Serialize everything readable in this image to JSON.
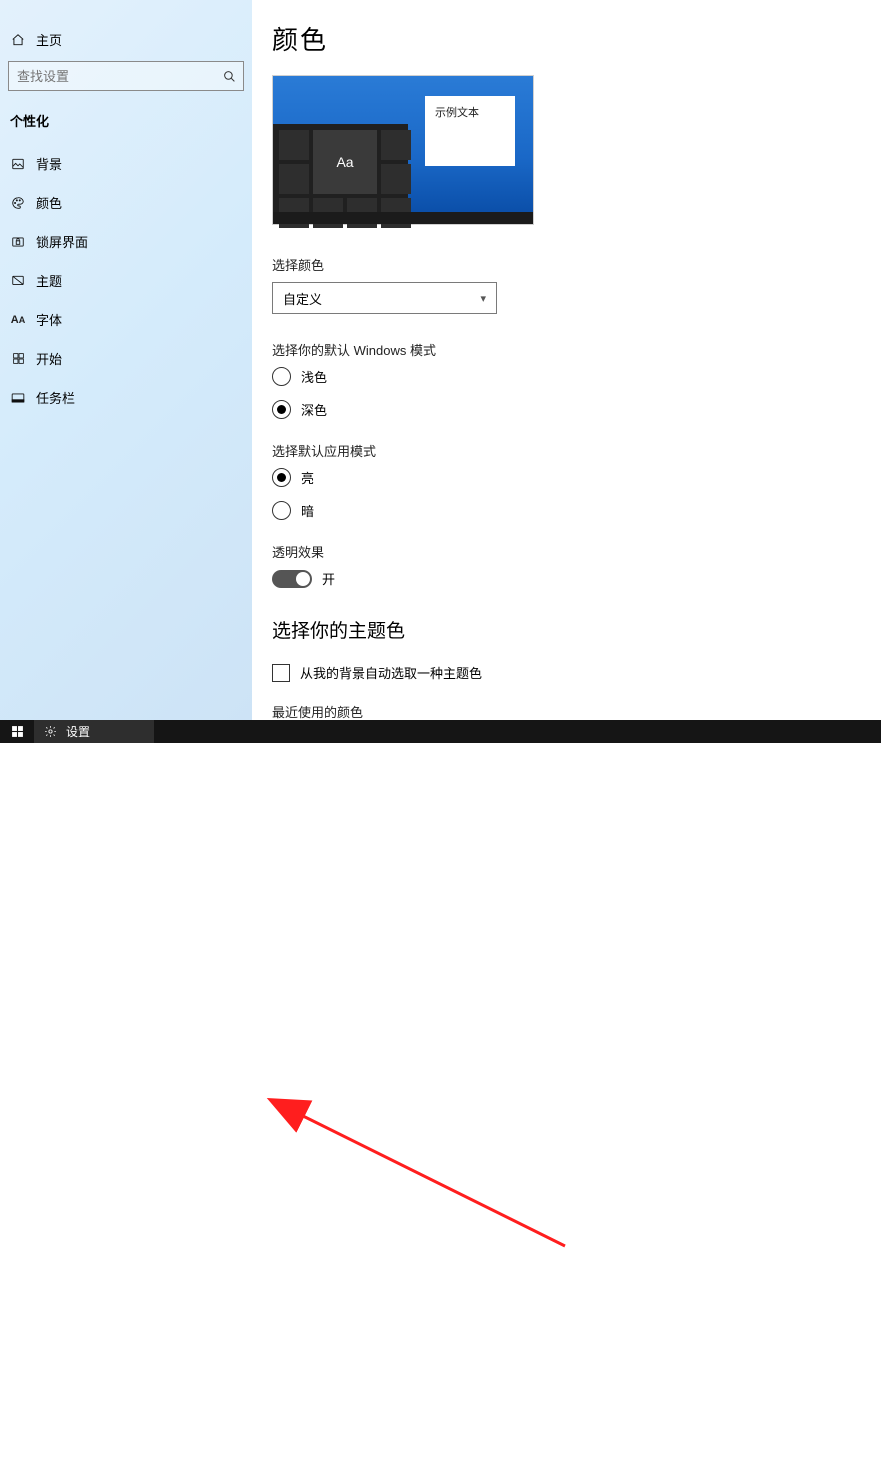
{
  "sidebar": {
    "home_label": "主页",
    "search_placeholder": "查找设置",
    "section_title": "个性化",
    "items": [
      {
        "label": "背景"
      },
      {
        "label": "颜色"
      },
      {
        "label": "锁屏界面"
      },
      {
        "label": "主题"
      },
      {
        "label": "字体"
      },
      {
        "label": "开始"
      },
      {
        "label": "任务栏"
      }
    ]
  },
  "main": {
    "page_title": "颜色",
    "preview_sample": "示例文本",
    "choose_color_label": "选择颜色",
    "combo_value": "自定义",
    "win_mode_label": "选择你的默认 Windows 模式",
    "radio_light": "浅色",
    "radio_dark": "深色",
    "app_mode_label": "选择默认应用模式",
    "radio_app_light": "亮",
    "radio_app_dark": "暗",
    "transparency_label": "透明效果",
    "toggle_on": "开",
    "accent_title": "选择你的主题色",
    "auto_pick_label": "从我的背景自动选取一种主题色",
    "recent_label": "最近使用的颜色"
  },
  "taskbar": {
    "settings_label": "设置"
  }
}
